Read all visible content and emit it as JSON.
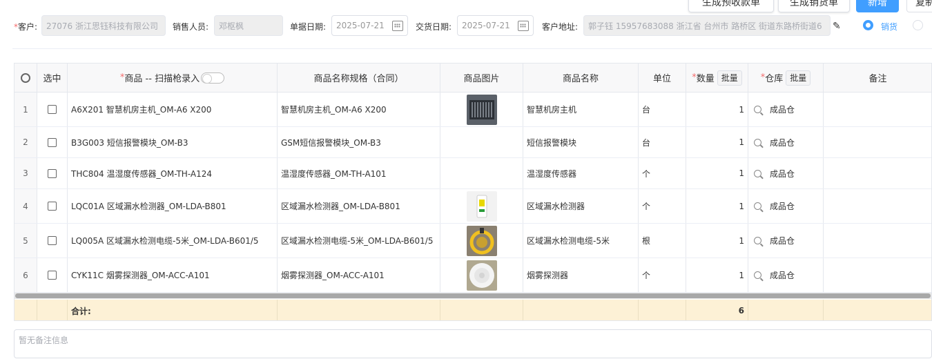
{
  "toolbar": {
    "btn_receipt": "生成预收款单",
    "btn_delivery": "生成销货单",
    "btn_new": "新增",
    "btn_copy": "复制"
  },
  "form": {
    "customer_label": "客户:",
    "customer_value": "27076 浙江思钰科技有限公司",
    "sales_label": "销售人员:",
    "sales_value": "邓枢枫",
    "order_date_label": "单据日期:",
    "order_date_value": "2025-07-21",
    "delivery_date_label": "交货日期:",
    "delivery_date_value": "2025-07-21",
    "address_label": "客户地址:",
    "address_value": "郭子钰 15957683088 浙江省 台州市 路桥区 街道东路桥街道6",
    "radio_sales_label": "销货",
    "radio_sales_checked": true
  },
  "table": {
    "headers": {
      "settings_icon": "gear-icon",
      "select": "选中",
      "product": "商品 -- 扫描枪录入",
      "spec": "商品名称规格（合同）",
      "image": "商品图片",
      "name": "商品名称",
      "unit": "单位",
      "qty": "数量",
      "qty_batch": "批量",
      "warehouse": "仓库",
      "warehouse_batch": "批量",
      "remark": "备注"
    },
    "rows": [
      {
        "idx": "1",
        "product": "A6X201 智慧机房主机_OM-A6 X200",
        "spec": "智慧机房主机_OM-A6 X200",
        "image": "device-photo",
        "name": "智慧机房主机",
        "unit": "台",
        "qty": "1",
        "warehouse": "成品仓"
      },
      {
        "idx": "2",
        "product": "B3G003 短信报警模块_OM-B3",
        "spec": "GSM短信报警模块_OM-B3",
        "image": "",
        "name": "短信报警模块",
        "unit": "台",
        "qty": "1",
        "warehouse": "成品仓"
      },
      {
        "idx": "3",
        "product": "THC804 温湿度传感器_OM-TH-A124",
        "spec": "温湿度传感器_OM-TH-A101",
        "image": "",
        "name": "温湿度传感器",
        "unit": "个",
        "qty": "1",
        "warehouse": "成品仓"
      },
      {
        "idx": "4",
        "product": "LQC01A 区域漏水检测器_OM-LDA-B801",
        "spec": "区域漏水检测器_OM-LDA-B801",
        "image": "detector-photo",
        "name": "区域漏水检测器",
        "unit": "个",
        "qty": "1",
        "warehouse": "成品仓"
      },
      {
        "idx": "5",
        "product": "LQ005A 区域漏水检测电缆-5米_OM-LDA-B601/5",
        "spec": "区域漏水检测电缆-5米_OM-LDA-B601/5",
        "image": "cable-photo",
        "name": "区域漏水检测电缆-5米",
        "unit": "根",
        "qty": "1",
        "warehouse": "成品仓"
      },
      {
        "idx": "6",
        "product": "CYK11C 烟雾探测器_OM-ACC-A101",
        "spec": "烟雾探测器_OM-ACC-A101",
        "image": "smoke-detector-photo",
        "name": "烟雾探测器",
        "unit": "个",
        "qty": "1",
        "warehouse": "成品仓"
      }
    ],
    "total_label": "合计:",
    "total_qty": "6"
  },
  "remark": {
    "placeholder": "暂无备注信息"
  },
  "colors": {
    "primary": "#409eff",
    "required": "#f56c6c",
    "total_bg": "#fdf1d6"
  }
}
